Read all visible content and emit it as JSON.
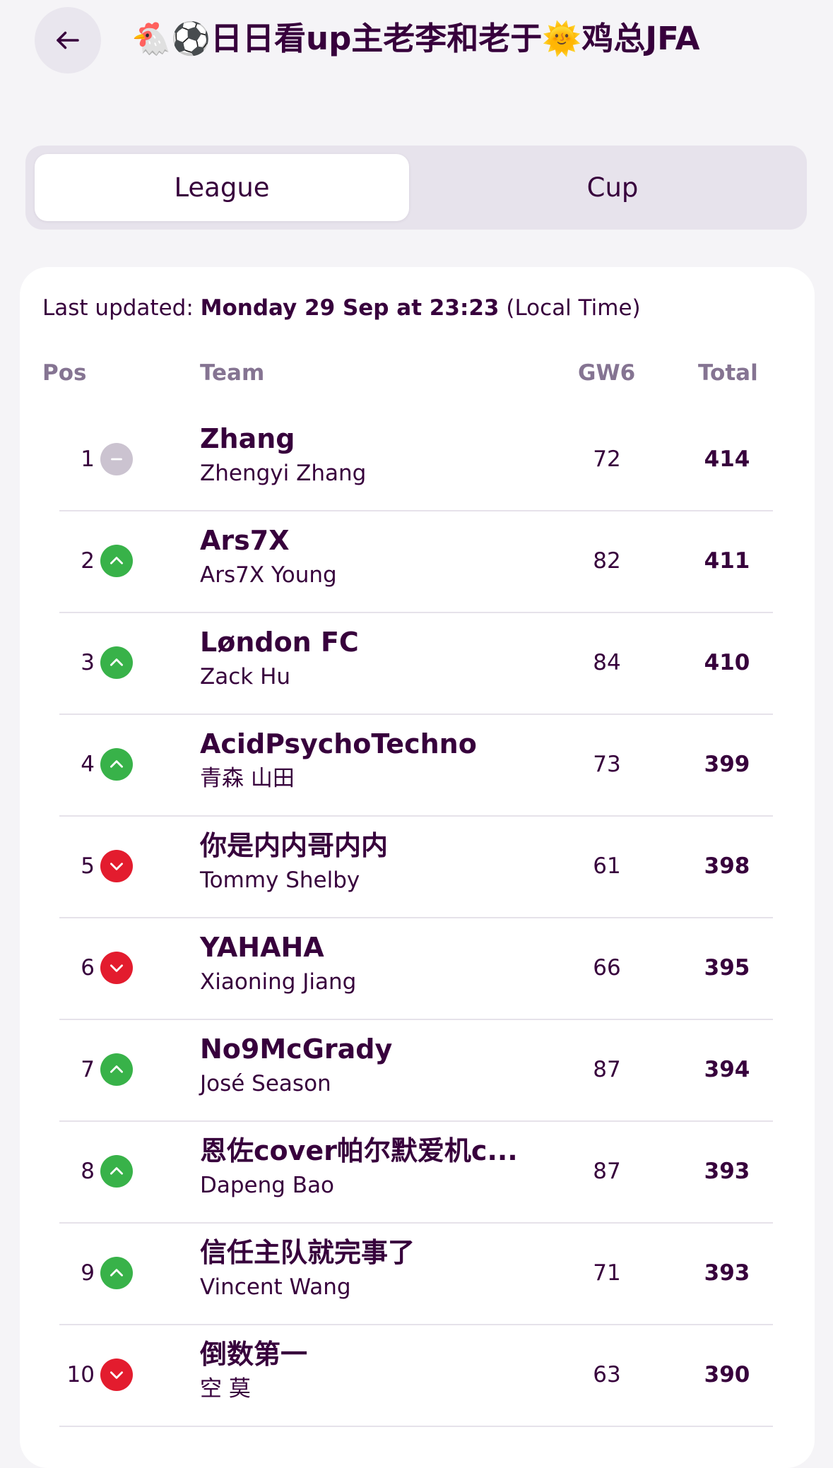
{
  "header": {
    "back_icon": "arrow-left-icon",
    "title": "🐔⚽日日看up主老李和老于🌞鸡总JFA"
  },
  "tabs": [
    {
      "label": "League",
      "active": true
    },
    {
      "label": "Cup",
      "active": false
    }
  ],
  "standings": {
    "last_updated_label": "Last updated:",
    "last_updated_value": "Monday 29 Sep at 23:23",
    "last_updated_suffix": "(Local Time)",
    "columns": {
      "pos": "Pos",
      "team": "Team",
      "gw": "GW6",
      "total": "Total"
    },
    "movement_colors": {
      "up": "#38b249",
      "down": "#e31c2e",
      "same": "#cbc3d0"
    },
    "rows": [
      {
        "pos": "1",
        "movement": "same",
        "team": "Zhang",
        "manager": "Zhengyi Zhang",
        "gw": "72",
        "total": "414"
      },
      {
        "pos": "2",
        "movement": "up",
        "team": "Ars7X",
        "manager": "Ars7X Young",
        "gw": "82",
        "total": "411"
      },
      {
        "pos": "3",
        "movement": "up",
        "team": "Løndon FC",
        "manager": "Zack Hu",
        "gw": "84",
        "total": "410"
      },
      {
        "pos": "4",
        "movement": "up",
        "team": "AcidPsychoTechno",
        "manager": "青森 山田",
        "gw": "73",
        "total": "399"
      },
      {
        "pos": "5",
        "movement": "down",
        "team": "你是内内哥内内",
        "manager": "Tommy Shelby",
        "gw": "61",
        "total": "398"
      },
      {
        "pos": "6",
        "movement": "down",
        "team": "YAHAHA",
        "manager": "Xiaoning Jiang",
        "gw": "66",
        "total": "395"
      },
      {
        "pos": "7",
        "movement": "up",
        "team": "No9McGrady",
        "manager": "José Season",
        "gw": "87",
        "total": "394"
      },
      {
        "pos": "8",
        "movement": "up",
        "team": "恩佐cover帕尔默爱机c...",
        "manager": "Dapeng Bao",
        "gw": "87",
        "total": "393"
      },
      {
        "pos": "9",
        "movement": "up",
        "team": "信任主队就完事了",
        "manager": "Vincent Wang",
        "gw": "71",
        "total": "393"
      },
      {
        "pos": "10",
        "movement": "down",
        "team": "倒数第一",
        "manager": "空 莫",
        "gw": "63",
        "total": "390"
      }
    ]
  }
}
